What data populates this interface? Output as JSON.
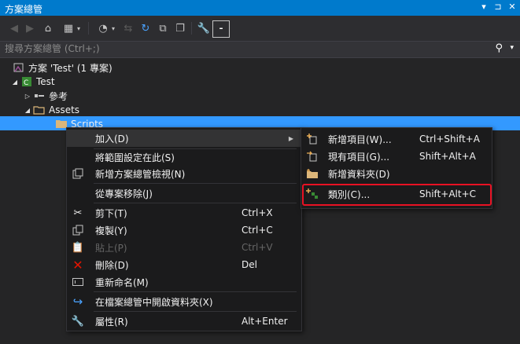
{
  "window": {
    "title": "方案總管",
    "controls": [
      "▾",
      "⊐",
      "✕"
    ]
  },
  "search": {
    "placeholder": "搜尋方案總管 (Ctrl+;)",
    "icon": "search-icon"
  },
  "tree": {
    "solution": "方案 'Test' (1 專案)",
    "project": "Test",
    "references": "參考",
    "assets": "Assets",
    "scripts": "Scripts"
  },
  "context_menu": {
    "items": [
      {
        "label": "加入(D)",
        "submenu": true
      },
      {
        "label": "將範圍設定在此(S)"
      },
      {
        "label": "新增方案總管檢視(N)"
      },
      {
        "label": "從專案移除(J)"
      },
      {
        "label": "剪下(T)",
        "shortcut": "Ctrl+X"
      },
      {
        "label": "複製(Y)",
        "shortcut": "Ctrl+C"
      },
      {
        "label": "貼上(P)",
        "shortcut": "Ctrl+V",
        "disabled": true
      },
      {
        "label": "刪除(D)",
        "shortcut": "Del"
      },
      {
        "label": "重新命名(M)"
      },
      {
        "label": "在檔案總管中開啟資料夾(X)"
      },
      {
        "label": "屬性(R)",
        "shortcut": "Alt+Enter"
      }
    ]
  },
  "submenu": {
    "items": [
      {
        "label": "新增項目(W)...",
        "shortcut": "Ctrl+Shift+A"
      },
      {
        "label": "現有項目(G)...",
        "shortcut": "Shift+Alt+A"
      },
      {
        "label": "新增資料夾(D)"
      },
      {
        "label": "類別(C)...",
        "shortcut": "Shift+Alt+C"
      }
    ]
  },
  "colors": {
    "accent": "#007acc",
    "selection": "#3399ff",
    "highlight_border": "#e81123"
  }
}
